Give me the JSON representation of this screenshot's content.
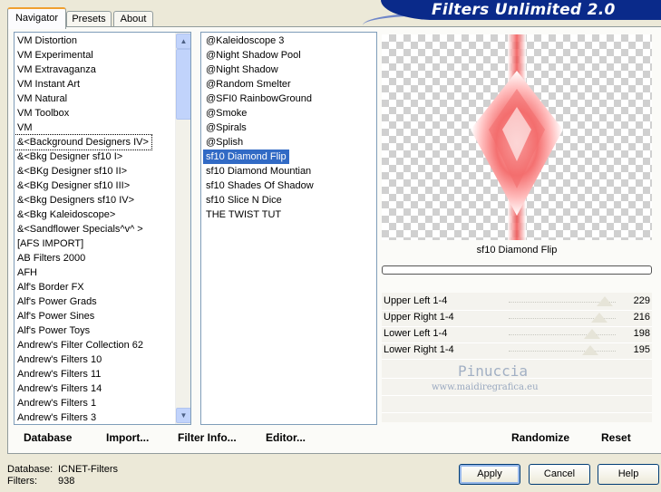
{
  "app": {
    "title": "Filters Unlimited 2.0"
  },
  "tabs": [
    {
      "label": "Navigator",
      "active": true
    },
    {
      "label": "Presets",
      "active": false
    },
    {
      "label": "About",
      "active": false
    }
  ],
  "categories": [
    "VM Distortion",
    "VM Experimental",
    "VM Extravaganza",
    "VM Instant Art",
    "VM Natural",
    "VM Toolbox",
    "VM",
    "&<Background Designers IV>",
    "&<Bkg Designer sf10 I>",
    "&<BKg Designer sf10 II>",
    "&<BKg Designer sf10 III>",
    "&<Bkg Designers sf10 IV>",
    "&<Bkg Kaleidoscope>",
    "&<Sandflower Specials^v^ >",
    "[AFS IMPORT]",
    "AB Filters 2000",
    "AFH",
    "Alf's Border FX",
    "Alf's Power Grads",
    "Alf's Power Sines",
    "Alf's Power Toys",
    "Andrew's Filter Collection 62",
    "Andrew's Filters 10",
    "Andrew's Filters 11",
    "Andrew's Filters 14",
    "Andrew's Filters 1",
    "Andrew's Filters 3"
  ],
  "selected_category_index": 7,
  "filters": [
    "@Kaleidoscope 3",
    "@Night Shadow Pool",
    "@Night Shadow",
    "@Random Smelter",
    "@SFI0 RainbowGround",
    "@Smoke",
    "@Spirals",
    "@Splish",
    "sf10 Diamond Flip",
    "sf10 Diamond Mountian",
    "sf10 Shades Of Shadow",
    "sf10 Slice N Dice",
    "THE TWIST TUT"
  ],
  "selected_filter_index": 8,
  "filter_name": "sf10 Diamond Flip",
  "progress": 0,
  "sliders": [
    {
      "label": "Upper Left 1-4",
      "value": "229",
      "fraction": 0.898
    },
    {
      "label": "Upper Right 1-4",
      "value": "216",
      "fraction": 0.847
    },
    {
      "label": "Lower Left 1-4",
      "value": "198",
      "fraction": 0.776
    },
    {
      "label": "Lower Right 1-4",
      "value": "195",
      "fraction": 0.765
    }
  ],
  "toolbar": {
    "database": "Database",
    "import": "Import...",
    "filter_info": "Filter Info...",
    "editor": "Editor...",
    "randomize": "Randomize",
    "reset": "Reset"
  },
  "status": {
    "database_label": "Database:",
    "database_value": "ICNET-Filters",
    "filters_label": "Filters:",
    "filters_value": "938"
  },
  "buttons": {
    "apply": "Apply",
    "cancel": "Cancel",
    "help": "Help"
  },
  "watermark": {
    "name": "Pinuccia",
    "url": "www.maidiregrafica.eu"
  },
  "colors": {
    "selection": "#316ac5",
    "banner": "#0a2a8a",
    "preview_accent": "#f06060"
  }
}
